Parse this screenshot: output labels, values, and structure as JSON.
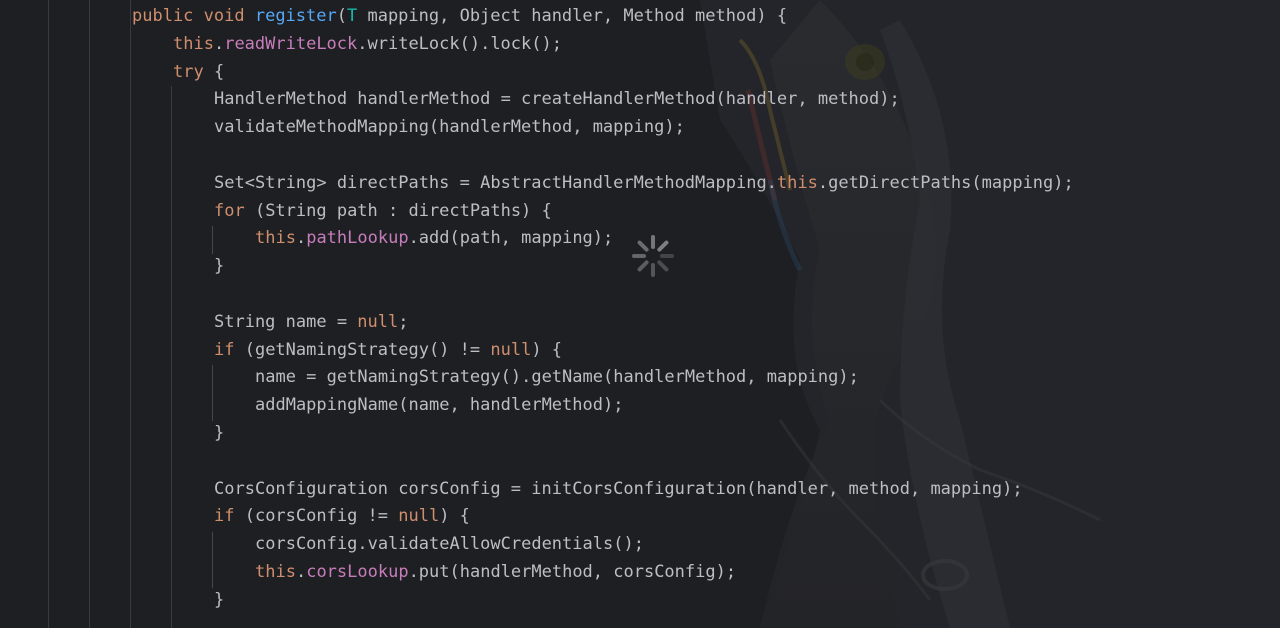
{
  "colors": {
    "background": "#1e1f22",
    "text": "#bcbec4",
    "keyword": "#cf8e6d",
    "method_decl": "#56a8f5",
    "type_param": "#16baac",
    "field": "#c77dbb",
    "indent_guide": "#393b40"
  },
  "spinner": {
    "icon": "loading-spinner-icon"
  },
  "code": {
    "lines": [
      {
        "indent": 2,
        "tokens": [
          {
            "t": "public ",
            "k": "kw"
          },
          {
            "t": "void ",
            "k": "kw"
          },
          {
            "t": "register",
            "k": "fn"
          },
          {
            "t": "(",
            "k": "pl"
          },
          {
            "t": "T",
            "k": "tp"
          },
          {
            "t": " mapping, Object handler, Method method) {",
            "k": "pl"
          }
        ]
      },
      {
        "indent": 3,
        "tokens": [
          {
            "t": "this",
            "k": "kw"
          },
          {
            "t": ".",
            "k": "pl"
          },
          {
            "t": "readWriteLock",
            "k": "fld"
          },
          {
            "t": ".writeLock().lock();",
            "k": "pl"
          }
        ]
      },
      {
        "indent": 3,
        "tokens": [
          {
            "t": "try",
            "k": "kw"
          },
          {
            "t": " {",
            "k": "pl"
          }
        ]
      },
      {
        "indent": 4,
        "tokens": [
          {
            "t": "HandlerMethod handlerMethod = createHandlerMethod(handler, method);",
            "k": "pl"
          }
        ]
      },
      {
        "indent": 4,
        "tokens": [
          {
            "t": "validateMethodMapping(handlerMethod, mapping);",
            "k": "pl"
          }
        ]
      },
      {
        "indent": 4,
        "tokens": []
      },
      {
        "indent": 4,
        "tokens": [
          {
            "t": "Set<String> directPaths = AbstractHandlerMethodMapping.",
            "k": "pl"
          },
          {
            "t": "this",
            "k": "kw"
          },
          {
            "t": ".getDirectPaths(mapping);",
            "k": "pl"
          }
        ]
      },
      {
        "indent": 4,
        "tokens": [
          {
            "t": "for",
            "k": "kw"
          },
          {
            "t": " (String path : directPaths) {",
            "k": "pl"
          }
        ]
      },
      {
        "indent": 5,
        "tokens": [
          {
            "t": "this",
            "k": "kw"
          },
          {
            "t": ".",
            "k": "pl"
          },
          {
            "t": "pathLookup",
            "k": "fld"
          },
          {
            "t": ".add(path, mapping);",
            "k": "pl"
          }
        ]
      },
      {
        "indent": 4,
        "tokens": [
          {
            "t": "}",
            "k": "pl"
          }
        ]
      },
      {
        "indent": 4,
        "tokens": []
      },
      {
        "indent": 4,
        "tokens": [
          {
            "t": "String name = ",
            "k": "pl"
          },
          {
            "t": "null",
            "k": "kw"
          },
          {
            "t": ";",
            "k": "pl"
          }
        ]
      },
      {
        "indent": 4,
        "tokens": [
          {
            "t": "if",
            "k": "kw"
          },
          {
            "t": " (getNamingStrategy() != ",
            "k": "pl"
          },
          {
            "t": "null",
            "k": "kw"
          },
          {
            "t": ") {",
            "k": "pl"
          }
        ]
      },
      {
        "indent": 5,
        "tokens": [
          {
            "t": "name = getNamingStrategy().getName(handlerMethod, mapping);",
            "k": "pl"
          }
        ]
      },
      {
        "indent": 5,
        "tokens": [
          {
            "t": "addMappingName(name, handlerMethod);",
            "k": "pl"
          }
        ]
      },
      {
        "indent": 4,
        "tokens": [
          {
            "t": "}",
            "k": "pl"
          }
        ]
      },
      {
        "indent": 4,
        "tokens": []
      },
      {
        "indent": 4,
        "tokens": [
          {
            "t": "CorsConfiguration corsConfig = initCorsConfiguration(handler, method, mapping);",
            "k": "pl"
          }
        ]
      },
      {
        "indent": 4,
        "tokens": [
          {
            "t": "if",
            "k": "kw"
          },
          {
            "t": " (corsConfig != ",
            "k": "pl"
          },
          {
            "t": "null",
            "k": "kw"
          },
          {
            "t": ") {",
            "k": "pl"
          }
        ]
      },
      {
        "indent": 5,
        "tokens": [
          {
            "t": "corsConfig.validateAllowCredentials();",
            "k": "pl"
          }
        ]
      },
      {
        "indent": 5,
        "tokens": [
          {
            "t": "this",
            "k": "kw"
          },
          {
            "t": ".",
            "k": "pl"
          },
          {
            "t": "corsLookup",
            "k": "fld"
          },
          {
            "t": ".put(handlerMethod, corsConfig);",
            "k": "pl"
          }
        ]
      },
      {
        "indent": 4,
        "tokens": [
          {
            "t": "}",
            "k": "pl"
          }
        ]
      }
    ]
  }
}
